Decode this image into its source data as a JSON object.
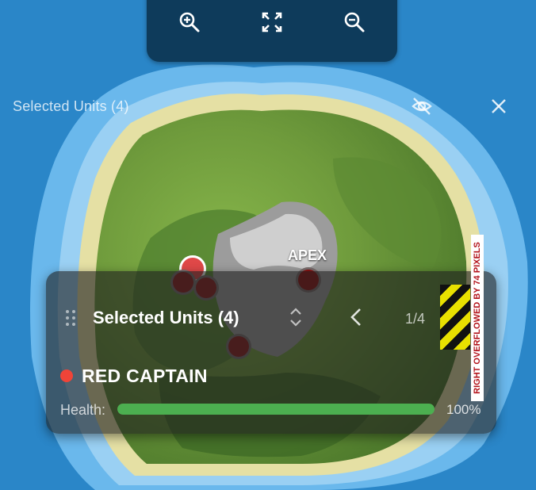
{
  "toolbar": {
    "zoom_in_icon": "zoom-in-icon",
    "fit_icon": "fullscreen-icon",
    "zoom_out_icon": "zoom-out-icon"
  },
  "header": {
    "title": "Selected Units (4)",
    "visibility_icon": "eye-off-icon",
    "close_icon": "close-icon"
  },
  "map": {
    "labels": [
      {
        "text": "APEX"
      }
    ]
  },
  "panel": {
    "title": "Selected Units (4)",
    "page": "1/4",
    "unit": {
      "name": "RED CAPTAIN",
      "team_color": "#f04438",
      "health_label": "Health:",
      "health_value": "100%",
      "health_fraction": 1.0
    }
  },
  "overflow_warning": "RIGHT OVERFLOWED BY 74 PIXELS",
  "colors": {
    "ocean": "#2a86c8",
    "health": "#4caf50",
    "toolbar": "#0e3b5b"
  }
}
